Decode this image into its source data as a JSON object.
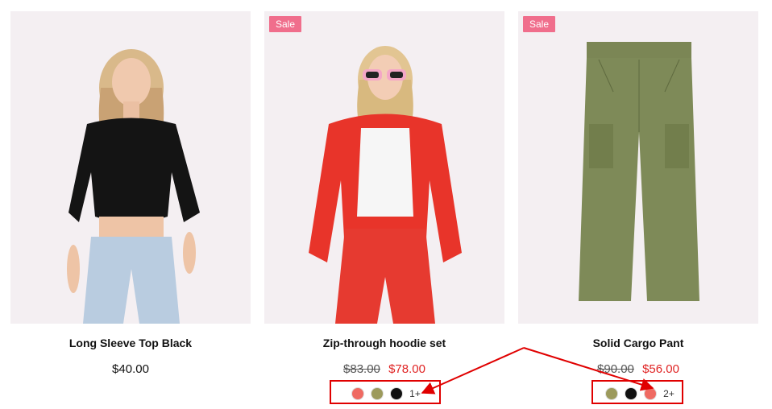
{
  "products": [
    {
      "title": "Long Sleeve Top Black",
      "price": "$40.00"
    },
    {
      "badge": "Sale",
      "title": "Zip-through hoodie set",
      "old_price": "$83.00",
      "price": "$78.00",
      "swatches": [
        "#ef6a62",
        "#9c9a5c",
        "#111111"
      ],
      "more": "1+"
    },
    {
      "badge": "Sale",
      "title": "Solid Cargo Pant",
      "old_price": "$90.00",
      "price": "$56.00",
      "swatches": [
        "#9c9a5c",
        "#111111",
        "#ef6a62"
      ],
      "more": "2+"
    }
  ],
  "annotation_color": "#e00000"
}
